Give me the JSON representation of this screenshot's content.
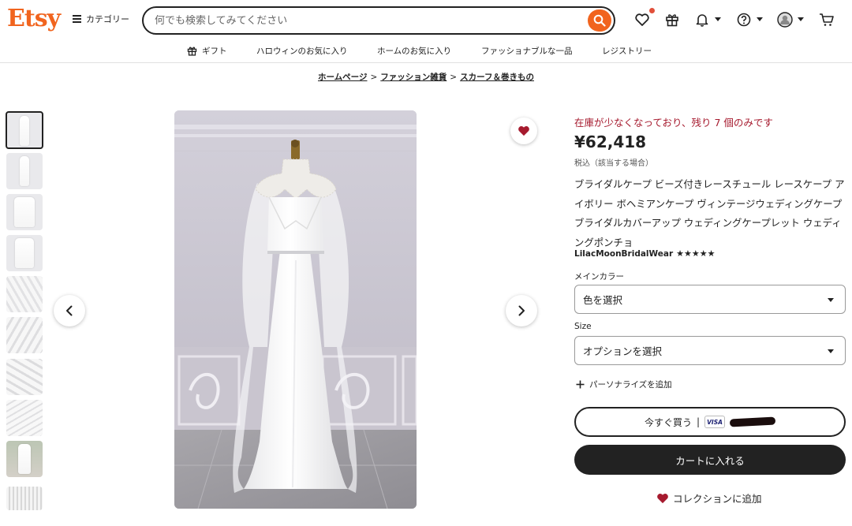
{
  "header": {
    "logo": "Etsy",
    "categories_label": "カテゴリー",
    "search_placeholder": "何でも検索してみてください"
  },
  "subnav": {
    "items": [
      {
        "label": "ギフト",
        "icon": "gift-icon"
      },
      {
        "label": "ハロウィンのお気に入り"
      },
      {
        "label": "ホームのお気に入り"
      },
      {
        "label": "ファッショナブルな一品"
      },
      {
        "label": "レジストリー"
      }
    ]
  },
  "breadcrumb": {
    "items": [
      "ホームページ",
      "ファッション雑貨",
      "スカーフ＆巻きもの"
    ],
    "separator": ">"
  },
  "listing": {
    "stock_notice": "在庫が少なくなっており、残り 7 個のみです",
    "price": "¥62,418",
    "tax_note": "税込（該当する場合）",
    "title": "ブライダルケープ ビーズ付きレースチュール レースケープ アイボリー ボヘミアンケープ ヴィンテージウェディングケープ ブライダルカバーアップ ウェディングケープレット ウェディングポンチョ",
    "shop_name": "LilacMoonBridalWear",
    "rating_stars": "★★★★★",
    "rating_value": 5
  },
  "options": {
    "color_label": "メインカラー",
    "color_value": "色を選択",
    "size_label": "Size",
    "size_value": "オプションを選択"
  },
  "actions": {
    "personalize": "パーソナライズを追加",
    "buy_now": "今すぐ買う",
    "buy_now_separator": "|",
    "visa": "VISA",
    "add_to_cart": "カートに入れる",
    "add_to_collection": "コレクションに追加"
  },
  "colors": {
    "brand": "#f1641e",
    "stock_red": "#a61a2e",
    "dark": "#222222",
    "fav_heart": "#a61a2e"
  }
}
